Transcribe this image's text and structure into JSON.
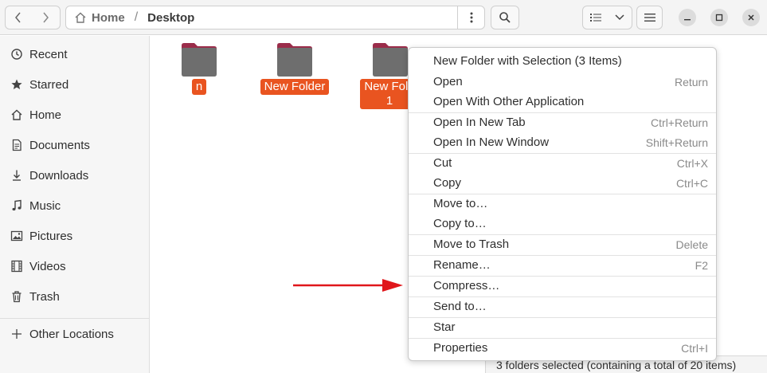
{
  "header": {
    "path": {
      "home": "Home",
      "separator": "/",
      "current": "Desktop"
    }
  },
  "sidebar": {
    "items": [
      {
        "label": "Recent",
        "icon": "clock-icon"
      },
      {
        "label": "Starred",
        "icon": "star-icon"
      },
      {
        "label": "Home",
        "icon": "home-icon"
      },
      {
        "label": "Documents",
        "icon": "document-icon"
      },
      {
        "label": "Downloads",
        "icon": "download-icon"
      },
      {
        "label": "Music",
        "icon": "music-note-icon"
      },
      {
        "label": "Pictures",
        "icon": "picture-icon"
      },
      {
        "label": "Videos",
        "icon": "film-icon"
      },
      {
        "label": "Trash",
        "icon": "trash-icon"
      }
    ],
    "other_locations": {
      "label": "Other Locations",
      "icon": "plus-icon"
    }
  },
  "folders": [
    {
      "label_lines": [
        "n"
      ]
    },
    {
      "label_lines": [
        "New Folder"
      ]
    },
    {
      "label_lines": [
        "New Fold",
        "1"
      ]
    }
  ],
  "context_menu": {
    "items": [
      {
        "label": "New Folder with Selection (3 Items)",
        "shortcut": ""
      },
      {
        "label": "Open",
        "shortcut": "Return"
      },
      {
        "label": "Open With Other Application",
        "shortcut": ""
      },
      {
        "label": "Open In New Tab",
        "shortcut": "Ctrl+Return"
      },
      {
        "label": "Open In New Window",
        "shortcut": "Shift+Return"
      },
      {
        "label": "Cut",
        "shortcut": "Ctrl+X"
      },
      {
        "label": "Copy",
        "shortcut": "Ctrl+C"
      },
      {
        "label": "Move to…",
        "shortcut": ""
      },
      {
        "label": "Copy to…",
        "shortcut": ""
      },
      {
        "label": "Move to Trash",
        "shortcut": "Delete"
      },
      {
        "label": "Rename…",
        "shortcut": "F2"
      },
      {
        "label": "Compress…",
        "shortcut": ""
      },
      {
        "label": "Send to…",
        "shortcut": ""
      },
      {
        "label": "Star",
        "shortcut": ""
      },
      {
        "label": "Properties",
        "shortcut": "Ctrl+I"
      }
    ]
  },
  "status": {
    "text": "3 folders selected  (containing a total of 20 items)"
  },
  "colors": {
    "accent": "#e95420",
    "annotation_arrow": "#e0161b",
    "folder_body": "#6e6e6e",
    "folder_tab": "#9b2c4a"
  }
}
